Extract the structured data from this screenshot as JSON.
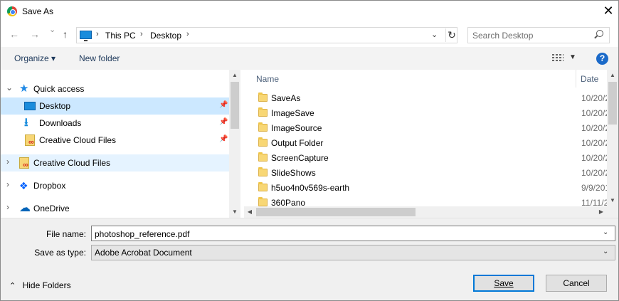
{
  "window": {
    "title": "Save As",
    "close_glyph": "✕"
  },
  "nav": {
    "back_glyph": "←",
    "forward_glyph": "→",
    "recent_glyph": "⌄",
    "up_glyph": "↑",
    "breadcrumb": [
      "This PC",
      "Desktop"
    ],
    "separator": "›",
    "dropdown_glyph": "⌄",
    "refresh_glyph": "↻",
    "search_placeholder": "Search Desktop"
  },
  "toolbar": {
    "organize_label": "Organize ▾",
    "new_folder_label": "New folder",
    "views_dropdown_glyph": "▼",
    "help_glyph": "?"
  },
  "sidebar": {
    "items": [
      {
        "label": "Quick access",
        "icon": "star-icon",
        "chev": "⌄"
      },
      {
        "label": "Desktop",
        "icon": "desktop-icon",
        "pin": "📌"
      },
      {
        "label": "Downloads",
        "icon": "download-icon",
        "pin": "📌"
      },
      {
        "label": "Creative Cloud Files",
        "icon": "creative-cloud-icon",
        "pin": "📌"
      },
      {
        "label": "Creative Cloud Files",
        "icon": "creative-cloud-icon",
        "chev": "›"
      },
      {
        "label": "Dropbox",
        "icon": "dropbox-icon",
        "chev": "›"
      },
      {
        "label": "OneDrive",
        "icon": "onedrive-icon",
        "chev": "›"
      }
    ],
    "scroll_up": "▲",
    "scroll_down": "▼"
  },
  "files": {
    "columns": {
      "name": "Name",
      "date": "Date"
    },
    "rows": [
      {
        "name": "SaveAs",
        "date": "10/20/2"
      },
      {
        "name": "ImageSave",
        "date": "10/20/2"
      },
      {
        "name": "ImageSource",
        "date": "10/20/2"
      },
      {
        "name": "Output Folder",
        "date": "10/20/2"
      },
      {
        "name": "ScreenCapture",
        "date": "10/20/2"
      },
      {
        "name": "SlideShows",
        "date": "10/20/2"
      },
      {
        "name": "h5uo4n0v569s-earth",
        "date": "9/9/201"
      },
      {
        "name": "360Pano",
        "date": "11/11/2"
      }
    ],
    "scroll_up": "▲",
    "scroll_down": "▼",
    "scroll_left": "◀",
    "scroll_right": "▶"
  },
  "form": {
    "file_name_label": "File name:",
    "file_name_value": "photoshop_reference.pdf",
    "save_type_label": "Save as type:",
    "save_type_value": "Adobe Acrobat Document",
    "dropdown_glyph": "⌄",
    "hide_folders_label": "Hide Folders",
    "hide_folders_glyph": "⌃",
    "save_label": "Save",
    "cancel_label": "Cancel"
  }
}
